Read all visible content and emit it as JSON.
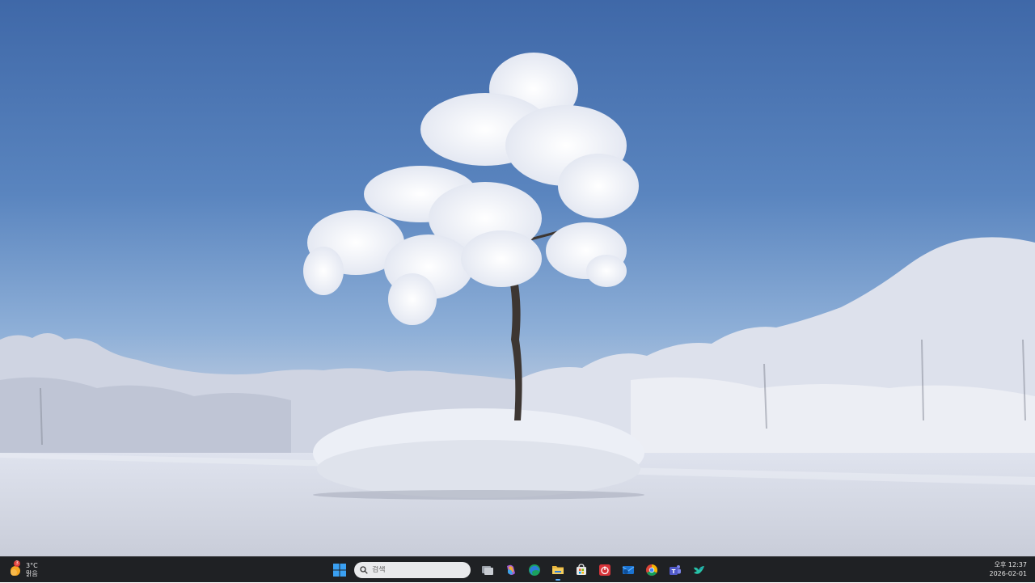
{
  "taskbar": {
    "weather": {
      "temperature": "3°C",
      "condition": "맑음",
      "badge_count": "3"
    },
    "search": {
      "placeholder": "검색"
    },
    "apps": [
      {
        "name": "start",
        "icon": "windows-logo-icon"
      },
      {
        "name": "task-view",
        "icon": "task-view-icon"
      },
      {
        "name": "copilot",
        "icon": "copilot-icon"
      },
      {
        "name": "edge",
        "icon": "edge-icon"
      },
      {
        "name": "file-explorer",
        "icon": "folder-icon"
      },
      {
        "name": "microsoft-store",
        "icon": "store-icon"
      },
      {
        "name": "red-app",
        "icon": "power-app-icon"
      },
      {
        "name": "outlook",
        "icon": "mail-icon"
      },
      {
        "name": "chrome",
        "icon": "chrome-icon"
      },
      {
        "name": "teams",
        "icon": "teams-icon"
      },
      {
        "name": "bird-app",
        "icon": "bird-icon"
      }
    ],
    "clock": {
      "time": "오후 12:37",
      "date": "2026-02-01"
    }
  },
  "colors": {
    "taskbar_bg": "#1f2124",
    "accent": "#5fb2ff"
  }
}
